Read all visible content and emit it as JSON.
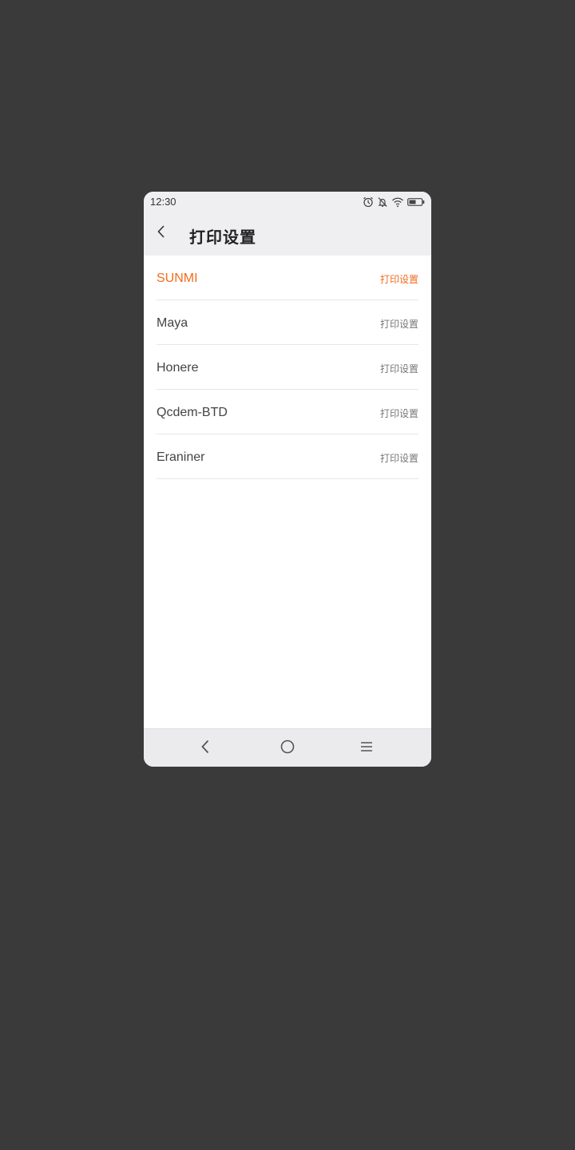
{
  "status_bar": {
    "time": "12:30",
    "icons": [
      "alarm-icon",
      "bell-muted-icon",
      "wifi-icon",
      "battery-icon"
    ]
  },
  "header": {
    "title": "打印设置",
    "back_icon": "chevron-left-icon"
  },
  "printers": [
    {
      "name": "SUNMI",
      "action": "打印设置",
      "active": true
    },
    {
      "name": "Maya",
      "action": "打印设置",
      "active": false
    },
    {
      "name": "Honere",
      "action": "打印设置",
      "active": false
    },
    {
      "name": "Qcdem-BTD",
      "action": "打印设置",
      "active": false
    },
    {
      "name": "Eraniner",
      "action": "打印设置",
      "active": false
    }
  ],
  "nav_bar": {
    "buttons": [
      "back-icon",
      "home-icon",
      "menu-icon"
    ]
  },
  "colors": {
    "accent": "#f26b1d",
    "background": "#3a3a3a",
    "header_bg": "#efeff1"
  }
}
